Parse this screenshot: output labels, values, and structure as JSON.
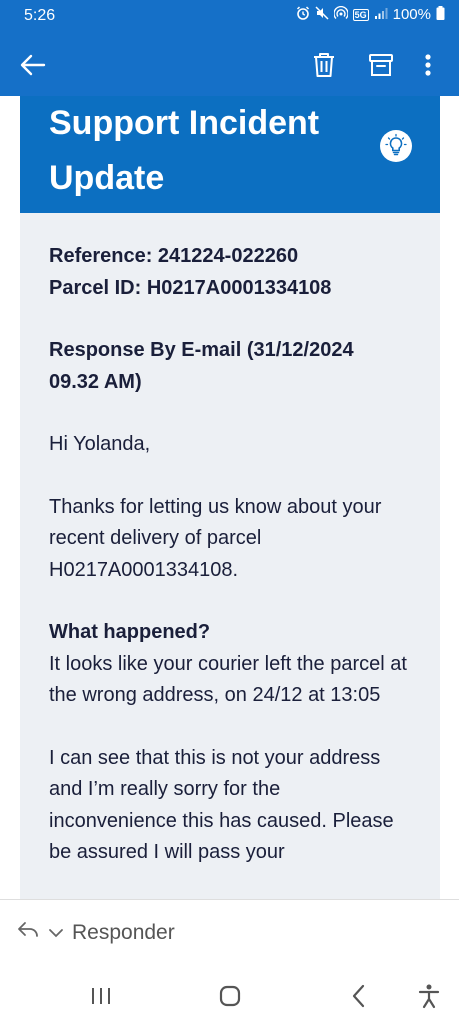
{
  "status_bar": {
    "time": "5:26",
    "network_label": "5G",
    "battery": "100%"
  },
  "app_bar": {
    "icons": [
      "back-arrow-icon",
      "trash-icon",
      "archive-icon",
      "more-vertical-icon"
    ]
  },
  "email": {
    "banner_title": "Support Incident Update",
    "reference_line": "Reference: 241224-022260",
    "parcel_line": "Parcel ID: H0217A0001334108",
    "response_line": "Response By E-mail (31/12/2024 09.32 AM)",
    "greeting": "Hi Yolanda,",
    "thanks_paragraph": "Thanks for letting us know about your recent delivery of parcel H0217A0001334108.",
    "what_happened_heading": "What happened?",
    "what_happened_text": "It looks like your courier left the parcel at the wrong address, on 24/12 at 13:05",
    "apology_paragraph": "I can see that this is not your address and I’m really sorry for the inconvenience this has caused. Please be assured I will pass your"
  },
  "reply_bar": {
    "reply_label": "Responder"
  },
  "colors": {
    "header_blue": "#1570c8",
    "banner_blue": "#0c6fc1",
    "email_bg": "#edf0f4",
    "text_dark": "#1a1f3a"
  }
}
